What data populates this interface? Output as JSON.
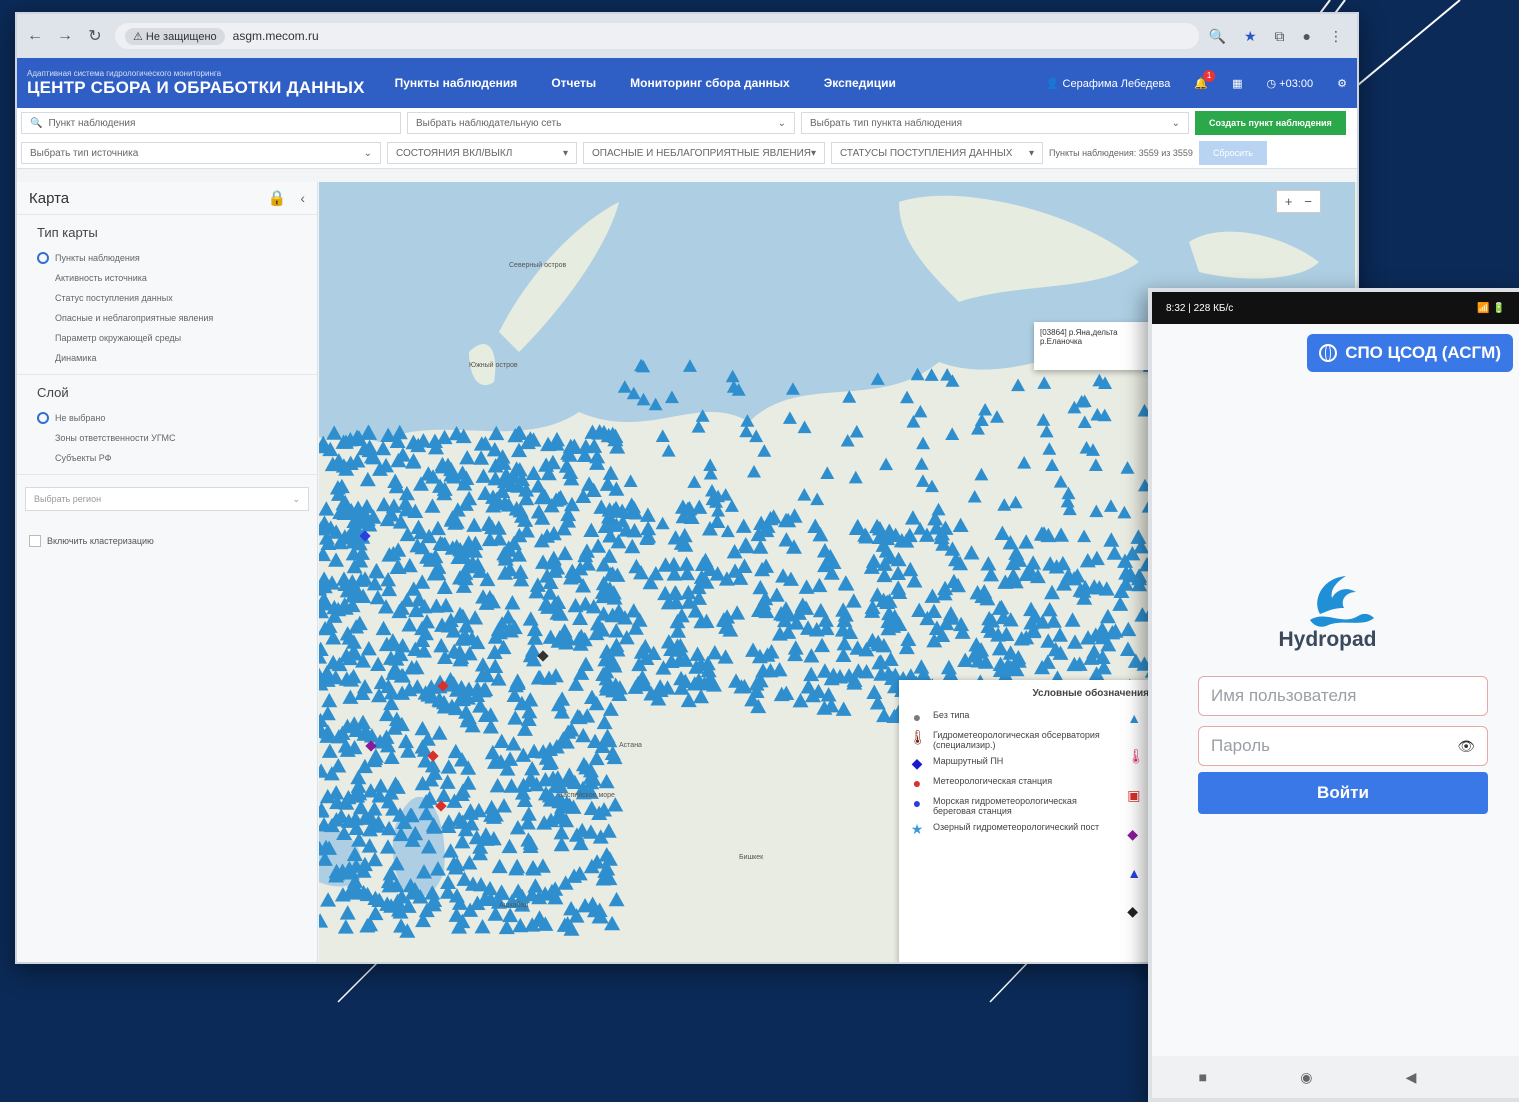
{
  "browser": {
    "secure_label": "Не защищено",
    "url": "asgm.mecom.ru"
  },
  "app": {
    "subtitle": "Адаптивная система гидрологического мониторинга",
    "title": "ЦЕНТР СБОРА И ОБРАБОТКИ ДАННЫХ",
    "menu": [
      "Пункты наблюдения",
      "Отчеты",
      "Мониторинг сбора данных",
      "Экспедиции"
    ],
    "user": "Серафима Лебедева",
    "notif_count": "1",
    "timezone": "+03:00"
  },
  "filters": {
    "search_placeholder": "Пункт наблюдения",
    "network_placeholder": "Выбрать наблюдательную сеть",
    "type_placeholder": "Выбрать тип пункта наблюдения",
    "create_button": "Создать пункт наблюдения",
    "source_type_placeholder": "Выбрать тип источника",
    "state": "СОСТОЯНИЯ ВКЛ/ВЫКЛ",
    "phenomena": "ОПАСНЫЕ И НЕБЛАГОПРИЯТНЫЕ ЯВЛЕНИЯ",
    "statuses": "СТАТУСЫ ПОСТУПЛЕНИЯ ДАННЫХ",
    "count": "Пункты наблюдения: 3559 из 3559",
    "reset_button": "Сбросить"
  },
  "sidebar": {
    "title": "Карта",
    "map_type_title": "Тип карты",
    "map_types": [
      "Пункты наблюдения",
      "Активность источника",
      "Статус поступления данных",
      "Опасные и неблагоприятные явления",
      "Параметр окружающей среды",
      "Динамика"
    ],
    "layer_title": "Слой",
    "layers": [
      "Не выбрано",
      "Зоны ответственности УГМС",
      "Субъекты РФ"
    ],
    "region_placeholder": "Выбрать регион",
    "cluster_label": "Включить кластеризацию"
  },
  "map": {
    "tooltip_line1": "[03864] р.Яна,дельта",
    "tooltip_line2": "р.Еланочка",
    "labels": [
      "Северный остров",
      "Южный остров",
      "Астана",
      "Ашхабад",
      "Бишкек",
      "Каспийское море"
    ]
  },
  "legend": {
    "title": "Условные обозначения",
    "items": [
      {
        "symbol": "●",
        "color": "#7a7a7a",
        "label": "Без типа"
      },
      {
        "symbol": "🌡",
        "color": "#7a2a18",
        "label": "Гидрометеорологическая обсерватория (специализир.)"
      },
      {
        "symbol": "◆",
        "color": "#1a1acc",
        "label": "Маршрутный ПН"
      },
      {
        "symbol": "●",
        "color": "#d9302c",
        "label": "Метеорологическая станция"
      },
      {
        "symbol": "●",
        "color": "#2a3fdc",
        "label": "Морская гидрометеорологическая береговая станция"
      },
      {
        "symbol": "★",
        "color": "#3a9ad9",
        "label": "Озерный гидрометеорологический пост"
      }
    ]
  },
  "phone": {
    "status_left": "8:32 | 228 КБ/с",
    "status_right": "📶 🔋",
    "spo_button": "СПО ЦСОД (АСГМ)",
    "app_name": "Hydropad",
    "username_placeholder": "Имя пользователя",
    "password_placeholder": "Пароль",
    "login_button": "Войти"
  },
  "colors": {
    "app_bar": "#2f5ec4",
    "marker": "#2f8fce",
    "accent_button": "#3b78e7",
    "background": "#0b2a57"
  }
}
